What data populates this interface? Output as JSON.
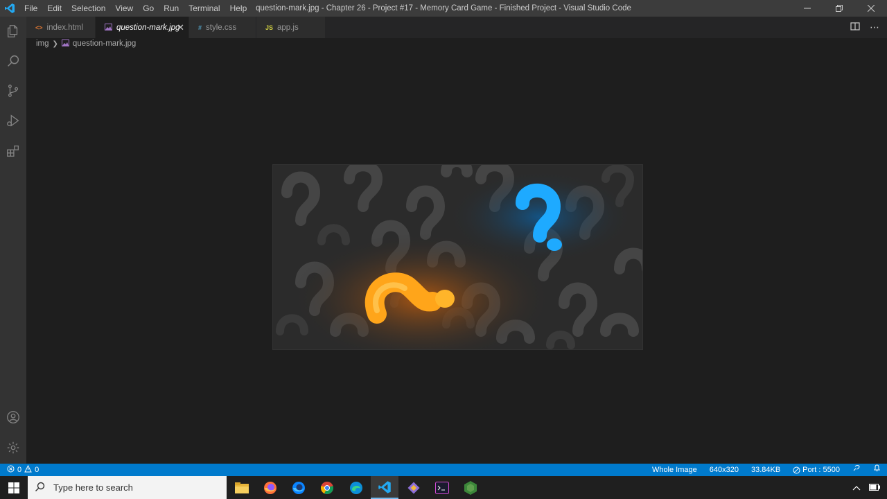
{
  "window": {
    "title": "question-mark.jpg - Chapter 26 - Project #17 - Memory Card Game - Finished Project - Visual Studio Code"
  },
  "menu": [
    "File",
    "Edit",
    "Selection",
    "View",
    "Go",
    "Run",
    "Terminal",
    "Help"
  ],
  "tabs": [
    {
      "label": "index.html",
      "icon": "<>",
      "icon_color": "#e37933",
      "active": false
    },
    {
      "label": "question-mark.jpg",
      "icon": "img",
      "icon_color": "#a074c4",
      "active": true
    },
    {
      "label": "style.css",
      "icon": "#",
      "icon_color": "#519aba",
      "active": false
    },
    {
      "label": "app.js",
      "icon": "JS",
      "icon_color": "#cbcb41",
      "active": false
    }
  ],
  "breadcrumb": {
    "folder": "img",
    "file": "question-mark.jpg"
  },
  "statusbar": {
    "errors": "0",
    "warnings": "0",
    "zoom_mode": "Whole Image",
    "dimensions": "640x320",
    "file_size": "33.84KB",
    "port": "Port : 5500"
  },
  "taskbar": {
    "search_placeholder": "Type here to search"
  },
  "colors": {
    "accent": "#007acc",
    "orange_glow": "#ffa51a",
    "blue_glow": "#1eaaff"
  }
}
